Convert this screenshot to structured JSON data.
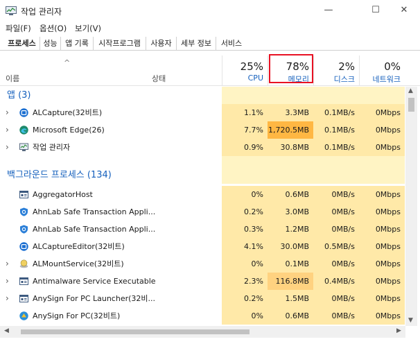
{
  "window": {
    "title": "작업 관리자",
    "min_glyph": "—",
    "max_glyph": "☐",
    "close_glyph": "✕"
  },
  "menu": [
    "파일(F)",
    "옵션(O)",
    "보기(V)"
  ],
  "tabs": [
    "프로세스",
    "성능",
    "앱 기록",
    "시작프로그램",
    "사용자",
    "세부 정보",
    "서비스"
  ],
  "active_tab": "프로세스",
  "columns": {
    "sort_glyph": "^",
    "name": "이름",
    "status": "상태",
    "cpu": {
      "pct": "25%",
      "label": "CPU"
    },
    "memory": {
      "pct": "78%",
      "label": "메모리"
    },
    "disk": {
      "pct": "2%",
      "label": "디스크"
    },
    "network": {
      "pct": "0%",
      "label": "네트워크"
    }
  },
  "groups": {
    "apps": "앱 (3)",
    "background": "백그라운드 프로세스 (134)"
  },
  "apps": [
    {
      "name": "ALCapture(32비트)",
      "icon": "alcapture-icon",
      "expandable": true,
      "cpu": "1.1%",
      "mem": "3.3MB",
      "disk": "0.1MB/s",
      "net": "0Mbps"
    },
    {
      "name": "Microsoft Edge(26)",
      "icon": "edge-icon",
      "expandable": true,
      "cpu": "7.7%",
      "mem": "1,720.5MB",
      "disk": "0.1MB/s",
      "net": "0Mbps"
    },
    {
      "name": "작업 관리자",
      "icon": "task-manager-icon",
      "expandable": true,
      "cpu": "0.9%",
      "mem": "30.8MB",
      "disk": "0.1MB/s",
      "net": "0Mbps"
    }
  ],
  "background": [
    {
      "name": "AggregatorHost",
      "icon": "window-app-icon",
      "expandable": false,
      "cpu": "0%",
      "mem": "0.6MB",
      "disk": "0MB/s",
      "net": "0Mbps"
    },
    {
      "name": "AhnLab Safe Transaction Appli...",
      "icon": "shield-icon",
      "expandable": false,
      "cpu": "0.2%",
      "mem": "3.0MB",
      "disk": "0MB/s",
      "net": "0Mbps"
    },
    {
      "name": "AhnLab Safe Transaction Appli...",
      "icon": "shield-icon",
      "expandable": false,
      "cpu": "0.3%",
      "mem": "1.2MB",
      "disk": "0MB/s",
      "net": "0Mbps"
    },
    {
      "name": "ALCaptureEditor(32비트)",
      "icon": "alcapture-icon",
      "expandable": false,
      "cpu": "4.1%",
      "mem": "30.0MB",
      "disk": "0.5MB/s",
      "net": "0Mbps"
    },
    {
      "name": "ALMountService(32비트)",
      "icon": "mount-icon",
      "expandable": true,
      "cpu": "0%",
      "mem": "0.1MB",
      "disk": "0MB/s",
      "net": "0Mbps"
    },
    {
      "name": "Antimalware Service Executable",
      "icon": "window-app-icon",
      "expandable": true,
      "cpu": "2.3%",
      "mem": "116.8MB",
      "disk": "0.4MB/s",
      "net": "0Mbps"
    },
    {
      "name": "AnySign For PC Launcher(32비...",
      "icon": "window-app-icon",
      "expandable": true,
      "cpu": "0.2%",
      "mem": "1.5MB",
      "disk": "0MB/s",
      "net": "0Mbps"
    },
    {
      "name": "AnySign For PC(32비트)",
      "icon": "anysign-icon",
      "expandable": false,
      "cpu": "0%",
      "mem": "0.6MB",
      "disk": "0MB/s",
      "net": "0Mbps"
    }
  ],
  "colors": {
    "heat_light": "#fff4c4",
    "heat_mid": "#ffe9a8",
    "heat_dark": "#ffd280",
    "heat_orange": "#ffb743",
    "accent": "#1560bd",
    "highlight_box": "#e81123"
  }
}
